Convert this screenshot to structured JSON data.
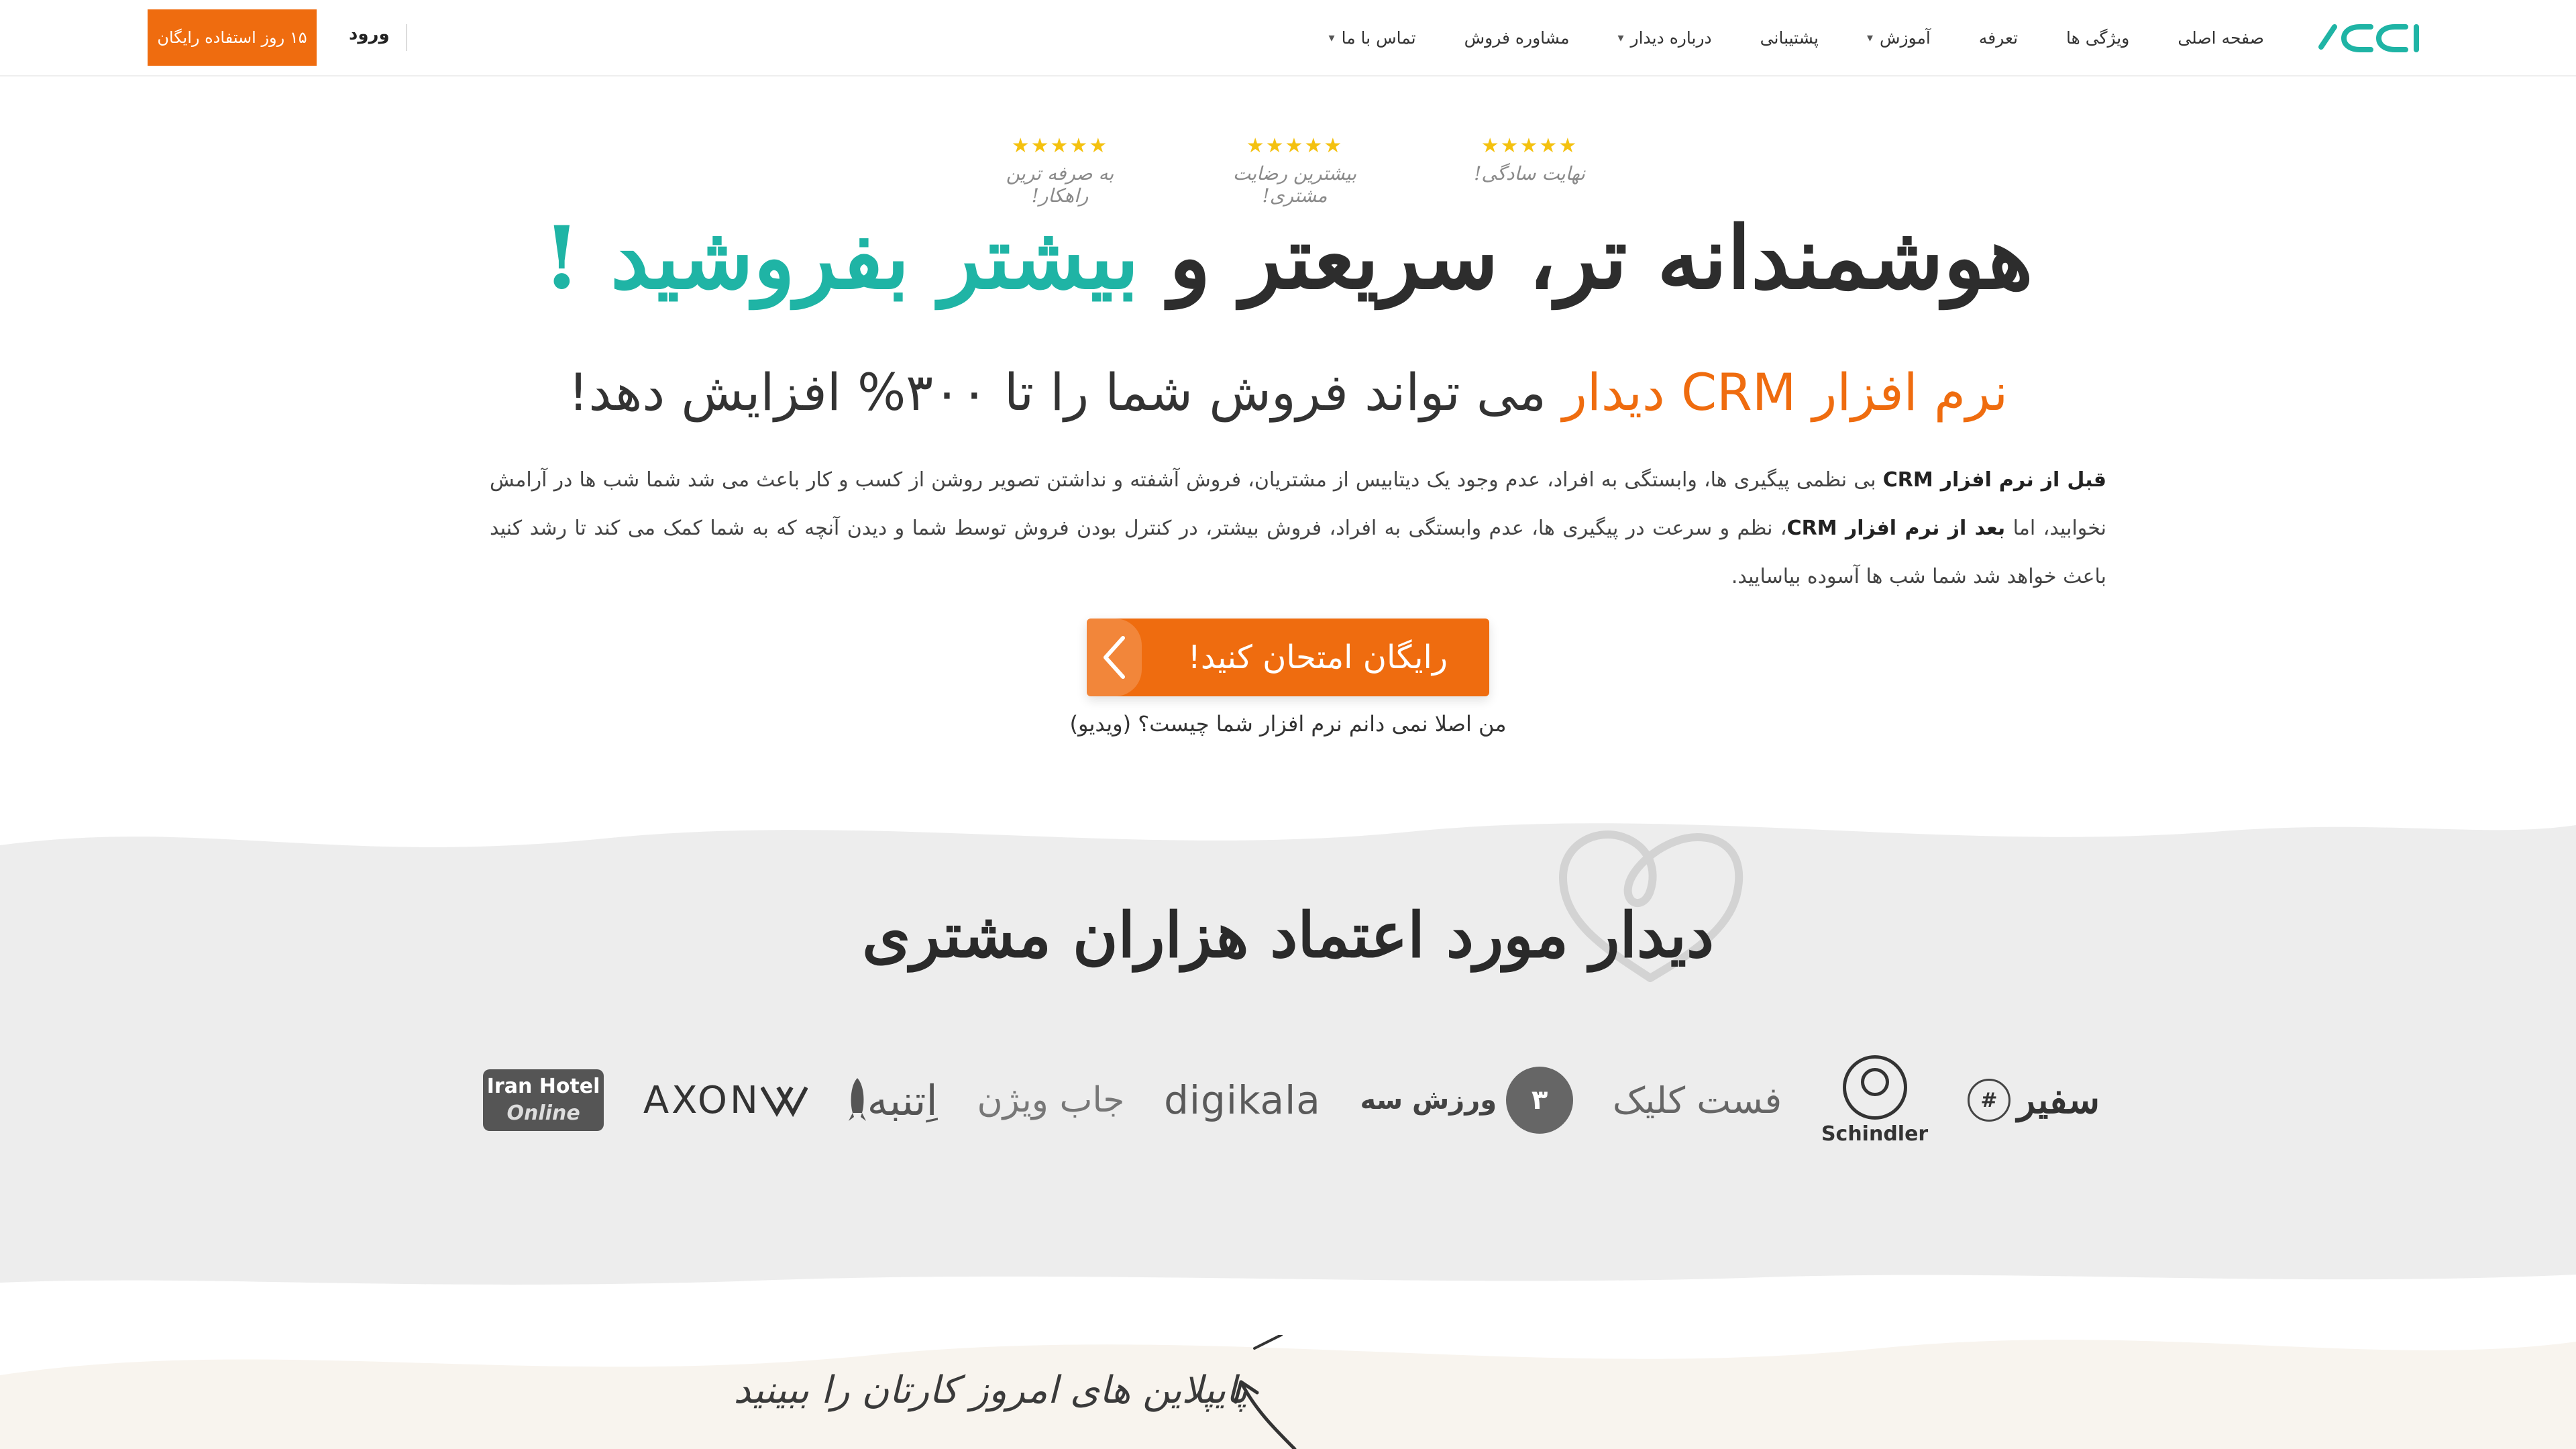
{
  "nav": {
    "menu": [
      {
        "label": "صفحه اصلی",
        "dropdown": false
      },
      {
        "label": "ویژگی ها",
        "dropdown": false
      },
      {
        "label": "تعرفه",
        "dropdown": false
      },
      {
        "label": "آموزش",
        "dropdown": true
      },
      {
        "label": "پشتیبانی",
        "dropdown": false
      },
      {
        "label": "درباره دیدار",
        "dropdown": true
      },
      {
        "label": "مشاوره فروش",
        "dropdown": false
      },
      {
        "label": "تماس با ما",
        "dropdown": true
      }
    ],
    "login_label": "ورود",
    "trial_label": "۱۵ روز استفاده رایگان"
  },
  "hero": {
    "ratings": [
      {
        "stars": "★★★★★",
        "caption": "نهایت سادگی!"
      },
      {
        "stars": "★★★★★",
        "caption": "بیشترین رضایت مشتری!"
      },
      {
        "stars": "★★★★★",
        "caption": "به صرفه ترین راهکار!"
      }
    ],
    "headline_part1": "هوشمندانه تر، سریعتر و ",
    "headline_accent": "بیشتر بفروشید !",
    "subhead_orange": "نرم افزار CRM دیدار",
    "subhead_rest": " می تواند فروش شما را تا ۳۰۰% افزایش دهد!",
    "para_bold1": "قبل از نرم افزار CRM",
    "para_text1": " بی نظمی پیگیری ها، وابستگی به افراد، عدم وجود یک دیتابیس از مشتریان، فروش آشفته و نداشتن تصویر روشن از کسب و کار باعث می شد شما شب ها در آرامش نخوابید، اما ",
    "para_bold2": "بعد از نرم افزار CRM",
    "para_text2": "، نظم و سرعت در پیگیری ها، عدم وابستگی به افراد، فروش بیشتر، در کنترل بودن فروش توسط شما و دیدن آنچه که به شما کمک می کند تا رشد کنید باعث خواهد شد شما شب ها آسوده بیاسایید.",
    "cta_label": "رایگان امتحان کنید!",
    "video_link": "من اصلا نمی دانم نرم افزار شما چیست؟ (ویدیو)"
  },
  "trust": {
    "title": "دیدار مورد اعتماد هزاران مشتری",
    "logos": {
      "safir": "سفیر",
      "schindler": "Schindler",
      "fastclick": "فست کلیک",
      "varzesh3": "ورزش سه",
      "varzesh3_num": "۳",
      "digikala": "digikala",
      "jobvision": "جاب ویژن",
      "eata": "اِتنبه",
      "axon": "AXON",
      "iranhotel_1": "Iran Hotel",
      "iranhotel_2": "Online"
    }
  },
  "pipeline": {
    "text": "پایپلاین های امروز کارتان را ببینید"
  },
  "colors": {
    "brand_orange": "#ef6c0f",
    "brand_teal": "#1fb4a5",
    "star_yellow": "#f4c10f",
    "band_gray": "#ededed"
  }
}
